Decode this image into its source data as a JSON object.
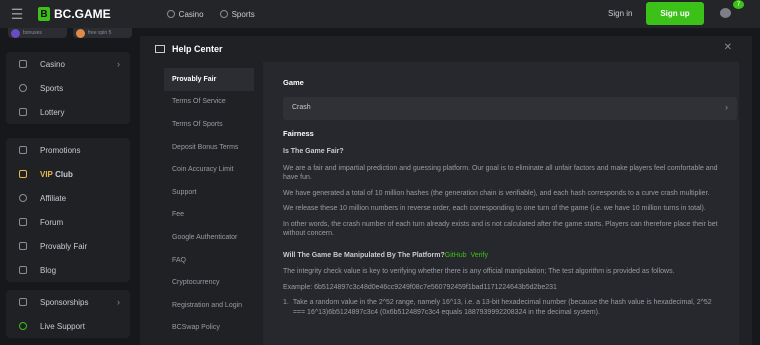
{
  "brand": {
    "name": "BC.GAME"
  },
  "top_nav": [
    {
      "label": "Casino",
      "icon": "casino-icon"
    },
    {
      "label": "Sports",
      "icon": "sports-icon"
    }
  ],
  "auth": {
    "signin": "Sign in",
    "signup": "Sign up",
    "notification_count": "7"
  },
  "promo": [
    {
      "label": "bonuses"
    },
    {
      "label": "free spin 5"
    }
  ],
  "sidebar": {
    "group1": [
      {
        "label": "Casino",
        "icon": "casino-icon",
        "chevron": true
      },
      {
        "label": "Sports",
        "icon": "sports-icon"
      },
      {
        "label": "Lottery",
        "icon": "lottery-icon"
      }
    ],
    "group2": [
      {
        "label": "Promotions",
        "icon": "promotions-icon"
      },
      {
        "label_a": "VIP",
        "label_b": "Club",
        "icon": "crown-icon"
      },
      {
        "label": "Affiliate",
        "icon": "affiliate-icon"
      },
      {
        "label": "Forum",
        "icon": "forum-icon"
      },
      {
        "label": "Provably Fair",
        "icon": "provably-fair-icon"
      },
      {
        "label": "Blog",
        "icon": "blog-icon"
      }
    ],
    "group3": [
      {
        "label": "Sponsorships",
        "icon": "sponsorships-icon",
        "chevron": true
      },
      {
        "label": "Live Support",
        "icon": "headset-icon"
      }
    ]
  },
  "help": {
    "title": "Help Center",
    "tabs": [
      "Provably Fair",
      "Terms Of Service",
      "Terms Of Sports",
      "Deposit Bonus Terms",
      "Coin Accuracy Limit",
      "Support",
      "Fee",
      "Google Authenticator",
      "FAQ",
      "Cryptocurrency",
      "Registration and Login",
      "BCSwap Policy"
    ],
    "active_tab": "Provably Fair",
    "game_label": "Game",
    "game_value": "Crash",
    "fairness_label": "Fairness",
    "q1": "Is The Game Fair?",
    "p1": "We are a fair and impartial prediction and guessing platform. Our goal is to eliminate all unfair factors and make players feel comfortable and have fun.",
    "p2": "We have generated a total of 10 million hashes (the generation chain is verifiable), and each hash corresponds to a curve crash multiplier.",
    "p3": "We release these 10 million numbers in reverse order, each corresponding to one turn of the game (i.e. we have 10 million turns in total).",
    "p4": "In other words, the crash number of each turn already exists and is not calculated after the game starts. Players can therefore place their bet without concern.",
    "q2": "Will The Game Be Manipulated By The Platform?",
    "q2_link1": "GitHub",
    "q2_link2": "Verify",
    "p5": "The integrity check value is key to verifying whether there is any official manipulation; The test algorithm is provided as follows.",
    "p6": "Example: 6b5124897c3c48d0e46cc9249f08c7e560792459f1bad1171224643b5d2be231",
    "li1_num": "1.",
    "li1": "Take a random value in the 2^52 range, namely 16^13, i.e. a 13-bit hexadecimal number (because the hash value is hexadecimal, 2^52 === 16^13)6b5124897c3c4 (0x6b5124897c3c4 equals 1887939992208324 in the decimal system)."
  },
  "colors": {
    "accent": "#3bc117",
    "vip": "#e9b84a",
    "bg": "#17181b",
    "panel": "#1f2125"
  }
}
